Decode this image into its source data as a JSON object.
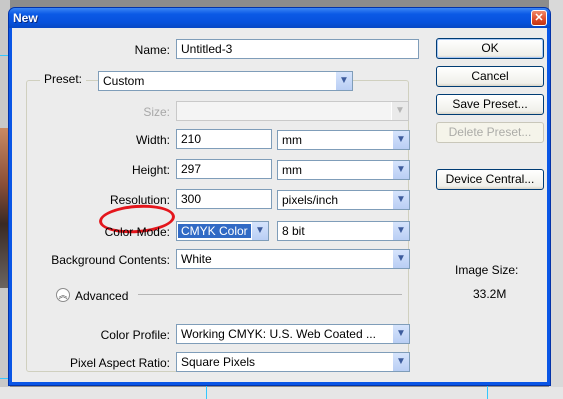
{
  "window": {
    "title": "New",
    "close_glyph": "✕"
  },
  "fields": {
    "name": {
      "label": "Name:",
      "value": "Untitled-3"
    },
    "preset": {
      "label": "Preset:",
      "value": "Custom"
    },
    "size": {
      "label": "Size:",
      "value": ""
    },
    "width": {
      "label": "Width:",
      "value": "210",
      "unit": "mm"
    },
    "height": {
      "label": "Height:",
      "value": "297",
      "unit": "mm"
    },
    "resolution": {
      "label": "Resolution:",
      "value": "300",
      "unit": "pixels/inch"
    },
    "color_mode": {
      "label": "Color Mode:",
      "mode": "CMYK Color",
      "depth": "8 bit"
    },
    "background": {
      "label": "Background Contents:",
      "value": "White"
    },
    "advanced": {
      "label": "Advanced"
    },
    "color_profile": {
      "label": "Color Profile:",
      "value": "Working CMYK:  U.S. Web Coated ..."
    },
    "pixel_aspect": {
      "label": "Pixel Aspect Ratio:",
      "value": "Square Pixels"
    }
  },
  "buttons": {
    "ok": "OK",
    "cancel": "Cancel",
    "save_preset": "Save Preset...",
    "delete_preset": "Delete Preset...",
    "device_central": "Device Central..."
  },
  "image_size": {
    "label": "Image Size:",
    "value": "33.2M"
  },
  "icons": {
    "dropdown": "chevron-down-icon",
    "advanced": "double-chevron-up-icon",
    "close": "close-icon",
    "dropdown_glyph": "▼",
    "advanced_glyph": "︽"
  },
  "colors": {
    "titlebar": "#0a56e6",
    "dialog_bg": "#ececec",
    "highlight": "#316ac5",
    "annotation": "#e4161c"
  }
}
